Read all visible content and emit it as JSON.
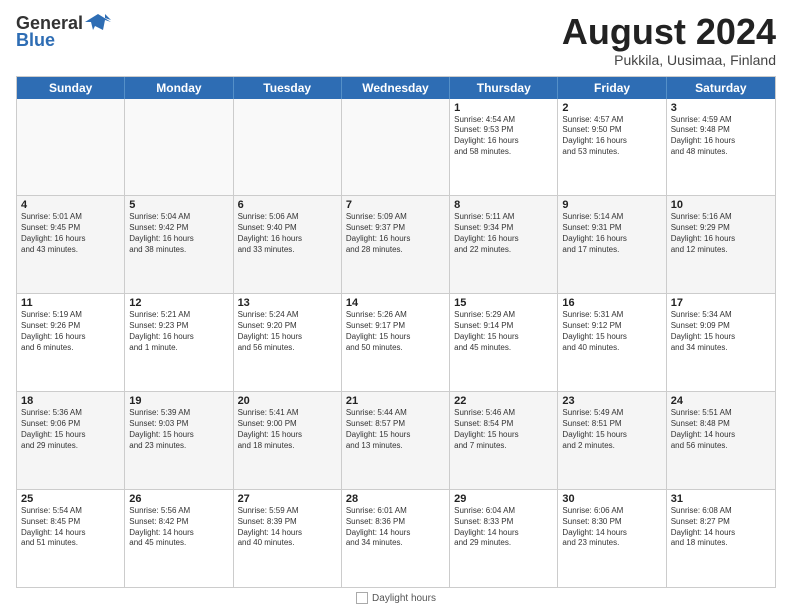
{
  "header": {
    "logo_line1": "General",
    "logo_line2": "Blue",
    "month_year": "August 2024",
    "location": "Pukkila, Uusimaa, Finland"
  },
  "weekdays": [
    "Sunday",
    "Monday",
    "Tuesday",
    "Wednesday",
    "Thursday",
    "Friday",
    "Saturday"
  ],
  "rows": [
    [
      {
        "day": "",
        "info": ""
      },
      {
        "day": "",
        "info": ""
      },
      {
        "day": "",
        "info": ""
      },
      {
        "day": "",
        "info": ""
      },
      {
        "day": "1",
        "info": "Sunrise: 4:54 AM\nSunset: 9:53 PM\nDaylight: 16 hours\nand 58 minutes."
      },
      {
        "day": "2",
        "info": "Sunrise: 4:57 AM\nSunset: 9:50 PM\nDaylight: 16 hours\nand 53 minutes."
      },
      {
        "day": "3",
        "info": "Sunrise: 4:59 AM\nSunset: 9:48 PM\nDaylight: 16 hours\nand 48 minutes."
      }
    ],
    [
      {
        "day": "4",
        "info": "Sunrise: 5:01 AM\nSunset: 9:45 PM\nDaylight: 16 hours\nand 43 minutes."
      },
      {
        "day": "5",
        "info": "Sunrise: 5:04 AM\nSunset: 9:42 PM\nDaylight: 16 hours\nand 38 minutes."
      },
      {
        "day": "6",
        "info": "Sunrise: 5:06 AM\nSunset: 9:40 PM\nDaylight: 16 hours\nand 33 minutes."
      },
      {
        "day": "7",
        "info": "Sunrise: 5:09 AM\nSunset: 9:37 PM\nDaylight: 16 hours\nand 28 minutes."
      },
      {
        "day": "8",
        "info": "Sunrise: 5:11 AM\nSunset: 9:34 PM\nDaylight: 16 hours\nand 22 minutes."
      },
      {
        "day": "9",
        "info": "Sunrise: 5:14 AM\nSunset: 9:31 PM\nDaylight: 16 hours\nand 17 minutes."
      },
      {
        "day": "10",
        "info": "Sunrise: 5:16 AM\nSunset: 9:29 PM\nDaylight: 16 hours\nand 12 minutes."
      }
    ],
    [
      {
        "day": "11",
        "info": "Sunrise: 5:19 AM\nSunset: 9:26 PM\nDaylight: 16 hours\nand 6 minutes."
      },
      {
        "day": "12",
        "info": "Sunrise: 5:21 AM\nSunset: 9:23 PM\nDaylight: 16 hours\nand 1 minute."
      },
      {
        "day": "13",
        "info": "Sunrise: 5:24 AM\nSunset: 9:20 PM\nDaylight: 15 hours\nand 56 minutes."
      },
      {
        "day": "14",
        "info": "Sunrise: 5:26 AM\nSunset: 9:17 PM\nDaylight: 15 hours\nand 50 minutes."
      },
      {
        "day": "15",
        "info": "Sunrise: 5:29 AM\nSunset: 9:14 PM\nDaylight: 15 hours\nand 45 minutes."
      },
      {
        "day": "16",
        "info": "Sunrise: 5:31 AM\nSunset: 9:12 PM\nDaylight: 15 hours\nand 40 minutes."
      },
      {
        "day": "17",
        "info": "Sunrise: 5:34 AM\nSunset: 9:09 PM\nDaylight: 15 hours\nand 34 minutes."
      }
    ],
    [
      {
        "day": "18",
        "info": "Sunrise: 5:36 AM\nSunset: 9:06 PM\nDaylight: 15 hours\nand 29 minutes."
      },
      {
        "day": "19",
        "info": "Sunrise: 5:39 AM\nSunset: 9:03 PM\nDaylight: 15 hours\nand 23 minutes."
      },
      {
        "day": "20",
        "info": "Sunrise: 5:41 AM\nSunset: 9:00 PM\nDaylight: 15 hours\nand 18 minutes."
      },
      {
        "day": "21",
        "info": "Sunrise: 5:44 AM\nSunset: 8:57 PM\nDaylight: 15 hours\nand 13 minutes."
      },
      {
        "day": "22",
        "info": "Sunrise: 5:46 AM\nSunset: 8:54 PM\nDaylight: 15 hours\nand 7 minutes."
      },
      {
        "day": "23",
        "info": "Sunrise: 5:49 AM\nSunset: 8:51 PM\nDaylight: 15 hours\nand 2 minutes."
      },
      {
        "day": "24",
        "info": "Sunrise: 5:51 AM\nSunset: 8:48 PM\nDaylight: 14 hours\nand 56 minutes."
      }
    ],
    [
      {
        "day": "25",
        "info": "Sunrise: 5:54 AM\nSunset: 8:45 PM\nDaylight: 14 hours\nand 51 minutes."
      },
      {
        "day": "26",
        "info": "Sunrise: 5:56 AM\nSunset: 8:42 PM\nDaylight: 14 hours\nand 45 minutes."
      },
      {
        "day": "27",
        "info": "Sunrise: 5:59 AM\nSunset: 8:39 PM\nDaylight: 14 hours\nand 40 minutes."
      },
      {
        "day": "28",
        "info": "Sunrise: 6:01 AM\nSunset: 8:36 PM\nDaylight: 14 hours\nand 34 minutes."
      },
      {
        "day": "29",
        "info": "Sunrise: 6:04 AM\nSunset: 8:33 PM\nDaylight: 14 hours\nand 29 minutes."
      },
      {
        "day": "30",
        "info": "Sunrise: 6:06 AM\nSunset: 8:30 PM\nDaylight: 14 hours\nand 23 minutes."
      },
      {
        "day": "31",
        "info": "Sunrise: 6:08 AM\nSunset: 8:27 PM\nDaylight: 14 hours\nand 18 minutes."
      }
    ]
  ],
  "footer": {
    "legend_label": "Daylight hours"
  }
}
